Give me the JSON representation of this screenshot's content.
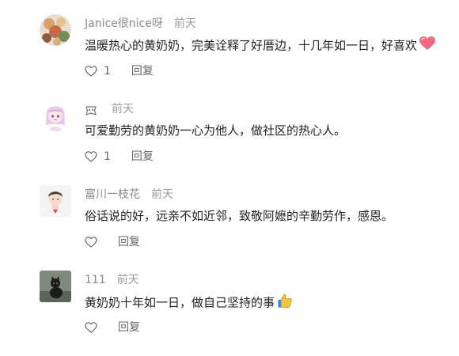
{
  "comments": [
    {
      "username": "Janice很nice呀",
      "time": "前天",
      "text": "温暖热心的黄奶奶，完美诠释了好厝边，十几年如一日，好喜欢",
      "emoji": "heart-emoji",
      "likes": "1",
      "reply_label": "回复"
    },
    {
      "username": "",
      "time": "前天",
      "text": "可爱勤劳的黄奶奶一心为他人，做社区的热心人。",
      "likes": "1",
      "reply_label": "回复"
    },
    {
      "username": "富川一枝花",
      "time": "前天",
      "text": "俗话说的好，远亲不如近邻，致敬阿嬷的辛勤劳作，感恩。",
      "likes": "",
      "reply_label": "回复"
    },
    {
      "username": "111",
      "time": "前天",
      "text": "黄奶奶十年如一日，做自己坚持的事",
      "emoji": "thumbs-up-emoji",
      "likes": "",
      "reply_label": "回复"
    }
  ]
}
